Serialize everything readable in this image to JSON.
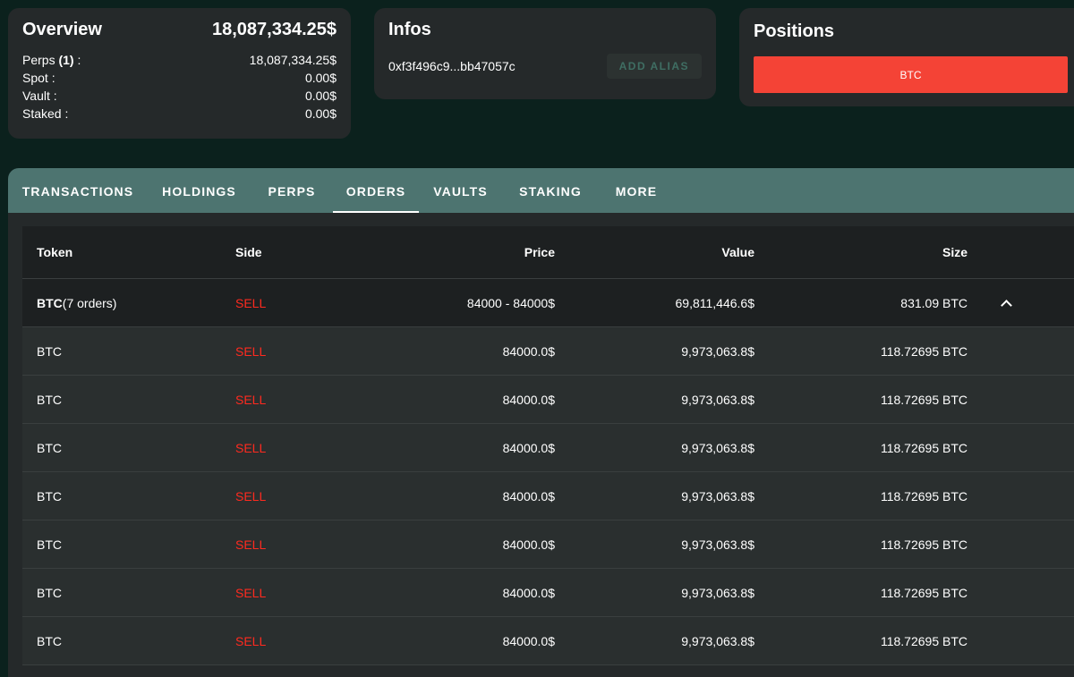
{
  "overview": {
    "title": "Overview",
    "total": "18,087,334.25$",
    "rows": [
      {
        "label": "Perps ",
        "badge": "(1)",
        "suffix": " :",
        "value": "18,087,334.25$"
      },
      {
        "label": "Spot :",
        "badge": "",
        "suffix": "",
        "value": "0.00$"
      },
      {
        "label": "Vault :",
        "badge": "",
        "suffix": "",
        "value": "0.00$"
      },
      {
        "label": "Staked :",
        "badge": "",
        "suffix": "",
        "value": "0.00$"
      }
    ]
  },
  "infos": {
    "title": "Infos",
    "address": "0xf3f496c9...bb47057c",
    "alias_button": "ADD ALIAS"
  },
  "positions": {
    "title": "Positions",
    "items": [
      "BTC"
    ]
  },
  "tabs": [
    "TRANSACTIONS",
    "HOLDINGS",
    "PERPS",
    "ORDERS",
    "VAULTS",
    "STAKING",
    "MORE"
  ],
  "active_tab": "ORDERS",
  "orders": {
    "columns": [
      "Token",
      "Side",
      "Price",
      "Value",
      "Size"
    ],
    "group": {
      "token": "BTC",
      "count_label": "(7 orders)",
      "side": "SELL",
      "price": "84000 - 84000$",
      "value": "69,811,446.6$",
      "size": "831.09 BTC",
      "expanded_icon": "chevron-up-icon"
    },
    "rows": [
      {
        "token": "BTC",
        "side": "SELL",
        "price": "84000.0$",
        "value": "9,973,063.8$",
        "size": "118.72695 BTC"
      },
      {
        "token": "BTC",
        "side": "SELL",
        "price": "84000.0$",
        "value": "9,973,063.8$",
        "size": "118.72695 BTC"
      },
      {
        "token": "BTC",
        "side": "SELL",
        "price": "84000.0$",
        "value": "9,973,063.8$",
        "size": "118.72695 BTC"
      },
      {
        "token": "BTC",
        "side": "SELL",
        "price": "84000.0$",
        "value": "9,973,063.8$",
        "size": "118.72695 BTC"
      },
      {
        "token": "BTC",
        "side": "SELL",
        "price": "84000.0$",
        "value": "9,973,063.8$",
        "size": "118.72695 BTC"
      },
      {
        "token": "BTC",
        "side": "SELL",
        "price": "84000.0$",
        "value": "9,973,063.8$",
        "size": "118.72695 BTC"
      },
      {
        "token": "BTC",
        "side": "SELL",
        "price": "84000.0$",
        "value": "9,973,063.8$",
        "size": "118.72695 BTC"
      }
    ]
  },
  "colors": {
    "background": "#0b211d",
    "card": "#25292a",
    "tabbar": "#4d7470",
    "sell": "#ff2a1f",
    "position_button": "#f44336"
  }
}
